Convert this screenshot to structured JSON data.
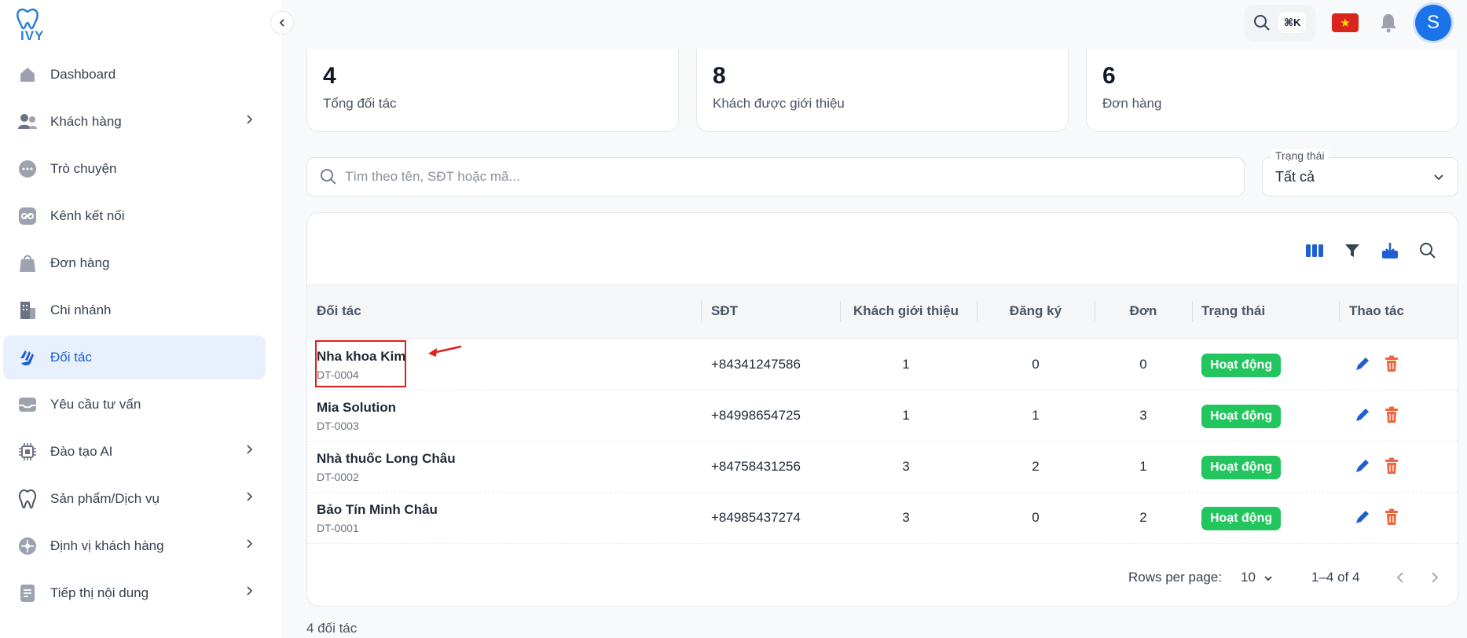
{
  "brand": {
    "logo_text": "IVY"
  },
  "sidebar": {
    "items": [
      {
        "label": "Dashboard",
        "icon": "home-icon",
        "has_children": false
      },
      {
        "label": "Khách hàng",
        "icon": "users-icon",
        "has_children": true
      },
      {
        "label": "Trò chuyện",
        "icon": "chat-icon",
        "has_children": false
      },
      {
        "label": "Kênh kết nối",
        "icon": "link-icon",
        "has_children": false
      },
      {
        "label": "Đơn hàng",
        "icon": "shopping-bag-icon",
        "has_children": false
      },
      {
        "label": "Chi nhánh",
        "icon": "building-icon",
        "has_children": false
      },
      {
        "label": "Đối tác",
        "icon": "handshake-icon",
        "has_children": false,
        "active": true
      },
      {
        "label": "Yêu cầu tư vấn",
        "icon": "inbox-icon",
        "has_children": false
      },
      {
        "label": "Đào tạo AI",
        "icon": "chip-icon",
        "has_children": true
      },
      {
        "label": "Sản phẩm/Dịch vụ",
        "icon": "tooth-icon",
        "has_children": true
      },
      {
        "label": "Định vị khách hàng",
        "icon": "target-icon",
        "has_children": true
      },
      {
        "label": "Tiếp thị nội dung",
        "icon": "document-icon",
        "has_children": true
      }
    ]
  },
  "topbar": {
    "shortcut": "⌘K",
    "avatar_initial": "S",
    "flag": "★"
  },
  "stats": [
    {
      "value": "4",
      "label": "Tổng đối tác"
    },
    {
      "value": "8",
      "label": "Khách được giới thiệu"
    },
    {
      "value": "6",
      "label": "Đơn hàng"
    }
  ],
  "search": {
    "placeholder": "Tìm theo tên, SĐT hoặc mã..."
  },
  "status_filter": {
    "label": "Trạng thái",
    "value": "Tất cả"
  },
  "table": {
    "columns": [
      "Đối tác",
      "SĐT",
      "Khách giới thiệu",
      "Đăng ký",
      "Đơn",
      "Trạng thái",
      "Thao tác"
    ],
    "rows": [
      {
        "name": "Nha khoa Kim",
        "code": "DT-0004",
        "phone": "+84341247586",
        "referred": "1",
        "registered": "0",
        "orders": "0",
        "status": "Hoạt động"
      },
      {
        "name": "Mia Solution",
        "code": "DT-0003",
        "phone": "+84998654725",
        "referred": "1",
        "registered": "1",
        "orders": "3",
        "status": "Hoạt động"
      },
      {
        "name": "Nhà thuốc Long Châu",
        "code": "DT-0002",
        "phone": "+84758431256",
        "referred": "3",
        "registered": "2",
        "orders": "1",
        "status": "Hoạt động"
      },
      {
        "name": "Bảo Tín Minh Châu",
        "code": "DT-0001",
        "phone": "+84985437274",
        "referred": "3",
        "registered": "0",
        "orders": "2",
        "status": "Hoạt động"
      }
    ]
  },
  "pagination": {
    "rows_per_page_label": "Rows per page:",
    "rows_per_page": "10",
    "range": "1–4 of 4"
  },
  "footer": {
    "total": "4 đối tác"
  },
  "colors": {
    "accent": "#1d5fd1",
    "status_active": "#22c55e",
    "delete": "#f0643c",
    "highlight": "#e01e1e"
  }
}
